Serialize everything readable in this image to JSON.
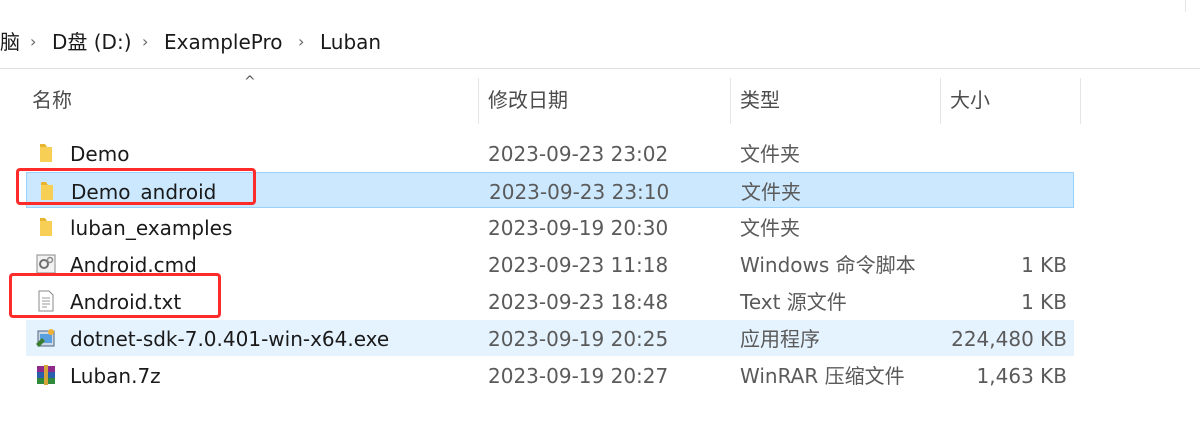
{
  "address": {
    "crumbs": [
      "脑",
      "D盘 (D:)",
      "ExamplePro",
      "Luban"
    ],
    "separator": "›"
  },
  "columns": {
    "name": "名称",
    "date": "修改日期",
    "type": "类型",
    "size": "大小"
  },
  "files": [
    {
      "name": "Demo",
      "date": "2023-09-23 23:02",
      "type": "文件夹",
      "size": "",
      "icon": "folder-icon"
    },
    {
      "name": "Demo_android",
      "date": "2023-09-23 23:10",
      "type": "文件夹",
      "size": "",
      "icon": "folder-icon",
      "selected": true
    },
    {
      "name": "luban_examples",
      "date": "2023-09-19 20:30",
      "type": "文件夹",
      "size": "",
      "icon": "folder-icon"
    },
    {
      "name": "Android.cmd",
      "date": "2023-09-23 11:18",
      "type": "Windows 命令脚本",
      "size": "1 KB",
      "icon": "cmd-script-icon"
    },
    {
      "name": "Android.txt",
      "date": "2023-09-23 18:48",
      "type": "Text 源文件",
      "size": "1 KB",
      "icon": "text-file-icon"
    },
    {
      "name": "dotnet-sdk-7.0.401-win-x64.exe",
      "date": "2023-09-19 20:25",
      "type": "应用程序",
      "size": "224,480 KB",
      "icon": "installer-icon",
      "hover": true
    },
    {
      "name": "Luban.7z",
      "date": "2023-09-19 20:27",
      "type": "WinRAR 压缩文件",
      "size": "1,463 KB",
      "icon": "winrar-archive-icon"
    }
  ],
  "colors": {
    "selection": "#cce8ff",
    "hover": "#e5f3ff",
    "annotation": "#ff2a2a",
    "folder": "#f5c542"
  }
}
